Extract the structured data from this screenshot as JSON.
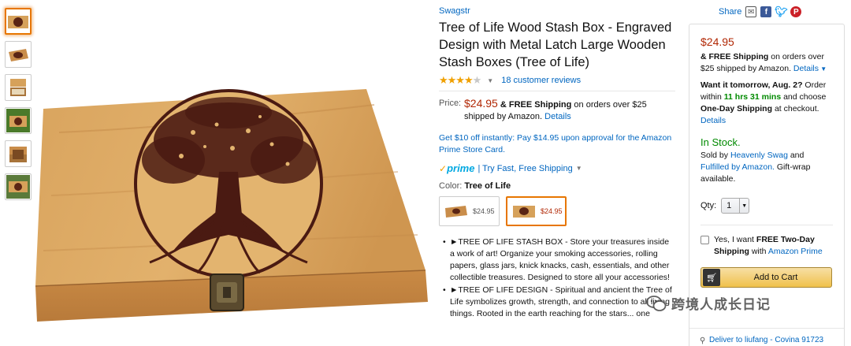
{
  "thumbnails": [
    {
      "name": "thumb-1",
      "selected": true
    },
    {
      "name": "thumb-2",
      "selected": false
    },
    {
      "name": "thumb-3",
      "selected": false
    },
    {
      "name": "thumb-4",
      "selected": false
    },
    {
      "name": "thumb-5",
      "selected": false
    },
    {
      "name": "thumb-6",
      "selected": false
    }
  ],
  "product": {
    "brand": "Swagstr",
    "title": "Tree of Life Wood Stash Box - Engraved Design with Metal Latch Large Wooden Stash Boxes (Tree of Life)",
    "rating_stars": 4,
    "reviews_text": "18 customer reviews",
    "price_label": "Price:",
    "price": "$24.95",
    "free_shipping": "& FREE Shipping",
    "shipping_rest": "on orders over $25 shipped by Amazon.",
    "details_link": "Details",
    "promo": "Get $10 off instantly: Pay $14.95 upon approval for the Amazon Prime Store Card.",
    "prime_text": "prime",
    "prime_try": "| Try Fast, Free Shipping",
    "color_label": "Color:",
    "color_value": "Tree of Life",
    "swatches": [
      {
        "price": "$24.95",
        "selected": false
      },
      {
        "price": "$24.95",
        "selected": true
      }
    ],
    "bullets": [
      "►TREE OF LIFE STASH BOX - Store your treasures inside a work of art! Organize your smoking accessories, rolling papers, glass jars, knick knacks, cash, essentials, and other collectible treasures. Designed to store all your accessories!",
      "►TREE OF LIFE DESIGN - Spiritual and ancient the Tree of Life symbolizes growth, strength, and connection to all living things. Rooted in the earth reaching for the stars... one"
    ]
  },
  "share": {
    "label": "Share"
  },
  "buybox": {
    "price": "$24.95",
    "free_shipping": "& FREE Shipping",
    "shipping_rest": "on orders over $25 shipped by Amazon.",
    "details": "Details",
    "want_it": "Want it tomorrow, Aug. 2?",
    "order_within": "Order within",
    "countdown": "11 hrs 31 mins",
    "and_choose": "and choose",
    "one_day": "One-Day Shipping",
    "at_checkout": "at checkout.",
    "details2": "Details",
    "in_stock": "In Stock.",
    "sold_by": "Sold by",
    "seller": "Heavenly Swag",
    "and": "and",
    "fulfilled": "Fulfilled by Amazon.",
    "gift_wrap": "Gift-wrap available.",
    "qty_label": "Qty:",
    "qty_value": "1",
    "twoday_prefix": "Yes, I want",
    "twoday_bold": "FREE Two-Day Shipping",
    "twoday_with": "with",
    "twoday_prime": "Amazon Prime",
    "add_to_cart": "Add to Cart",
    "deliver_to": "Deliver to liufang - Covina 91723"
  },
  "watermark": {
    "text": "跨境人成长日记"
  },
  "colors": {
    "link": "#0066c0",
    "price": "#b12704",
    "green": "#008a00",
    "orange": "#e77600",
    "wood": "#d6a15a",
    "engraving": "#4a1a12"
  }
}
